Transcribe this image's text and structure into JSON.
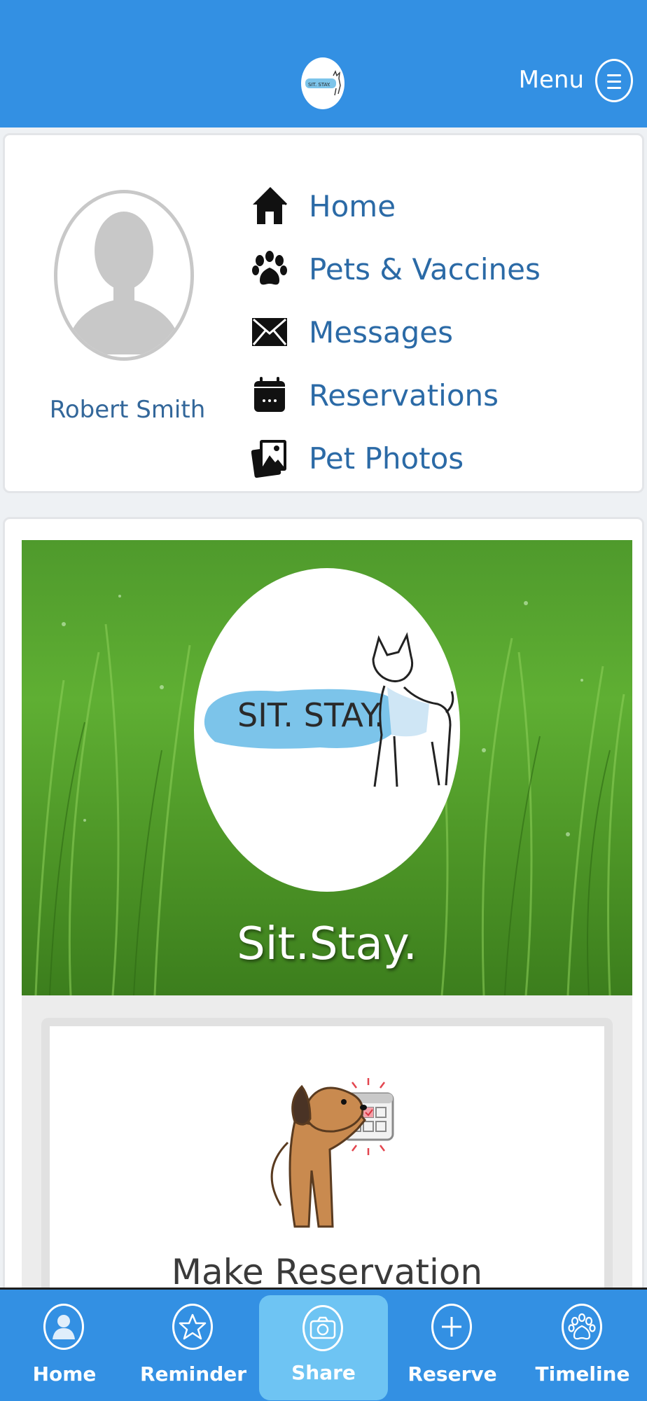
{
  "header": {
    "menu_label": "Menu",
    "logo_icon": "sit-stay-logo-icon",
    "menu_icon": "hamburger-icon",
    "brand_color": "#3390e3"
  },
  "profile": {
    "name": "Robert Smith",
    "avatar_icon": "person-silhouette-icon"
  },
  "nav": {
    "items": [
      {
        "label": "Home",
        "icon": "home-icon"
      },
      {
        "label": "Pets & Vaccines",
        "icon": "paw-icon"
      },
      {
        "label": "Messages",
        "icon": "envelope-icon"
      },
      {
        "label": "Reservations",
        "icon": "calendar-icon"
      },
      {
        "label": "Pet Photos",
        "icon": "photos-icon"
      }
    ],
    "label_color": "#2b6aa6"
  },
  "hero": {
    "logo_text": "SIT. STAY.",
    "title": "Sit.Stay."
  },
  "reservation_card": {
    "title": "Make Reservation",
    "illustration": "dog-calendar-illustration"
  },
  "tabbar": {
    "items": [
      {
        "label": "Home",
        "icon": "person-icon"
      },
      {
        "label": "Reminder",
        "icon": "star-icon"
      },
      {
        "label": "Share",
        "icon": "camera-icon",
        "active": true
      },
      {
        "label": "Reserve",
        "icon": "plus-icon"
      },
      {
        "label": "Timeline",
        "icon": "paw-icon"
      }
    ]
  }
}
